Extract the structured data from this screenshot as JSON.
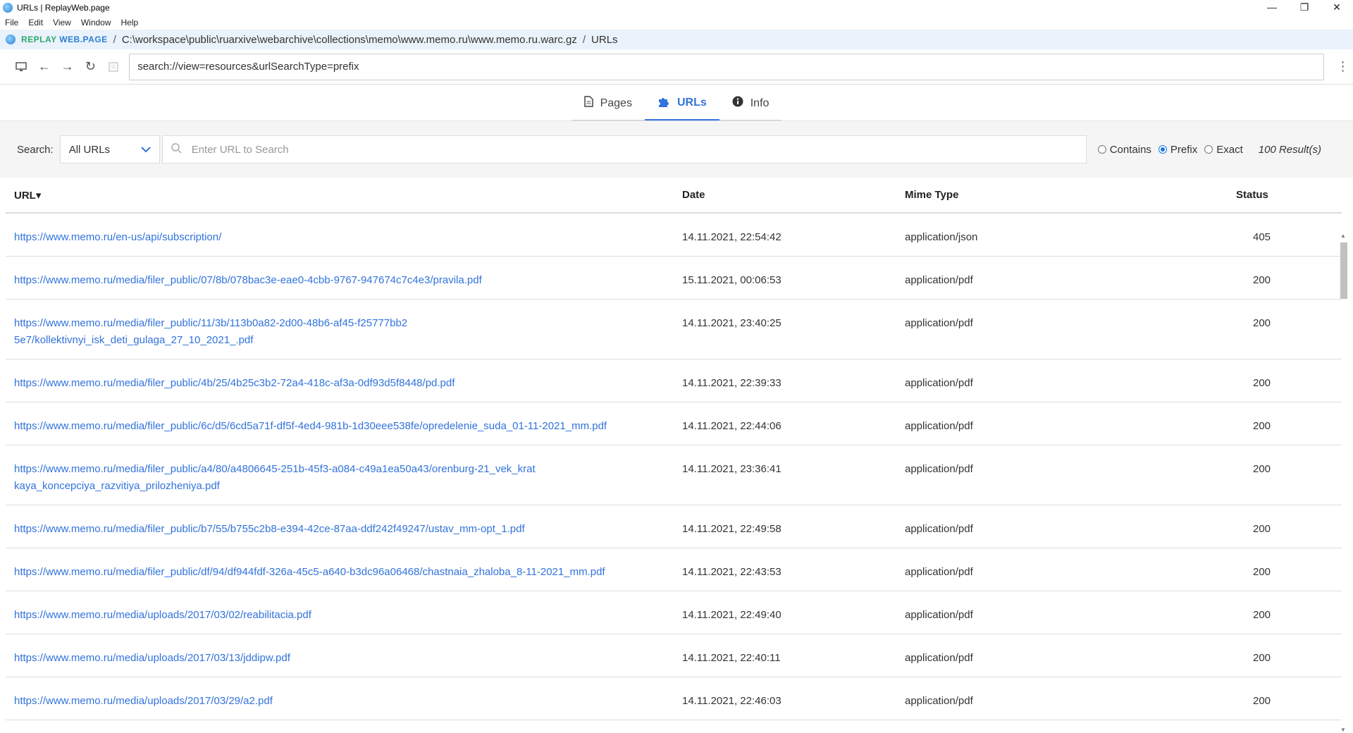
{
  "window": {
    "title": "URLs | ReplayWeb.page",
    "controls": [
      "—",
      "❐",
      "✕"
    ]
  },
  "menu": [
    "File",
    "Edit",
    "View",
    "Window",
    "Help"
  ],
  "breadcrumb": {
    "brand_replay": "REPLAY",
    "brand_web": "WEB.PAGE",
    "path": "C:\\workspace\\public\\ruarxive\\webarchive\\collections\\memo\\www.memo.ru\\www.memo.ru.warc.gz",
    "section": "URLs"
  },
  "address": {
    "value": "search://view=resources&urlSearchType=prefix"
  },
  "tabs": [
    {
      "label": "Pages",
      "icon": "page-icon",
      "active": false
    },
    {
      "label": "URLs",
      "icon": "puzzle-icon",
      "active": true
    },
    {
      "label": "Info",
      "icon": "info-icon",
      "active": false
    }
  ],
  "search": {
    "label": "Search:",
    "filter_value": "All URLs",
    "placeholder": "Enter URL to Search",
    "modes": [
      {
        "label": "Contains",
        "checked": false
      },
      {
        "label": "Prefix",
        "checked": true
      },
      {
        "label": "Exact",
        "checked": false
      }
    ],
    "results": "100 Result(s)"
  },
  "table": {
    "headers": {
      "url": "URL▾",
      "date": "Date",
      "mime": "Mime Type",
      "status": "Status"
    },
    "rows": [
      {
        "url": "https://www.memo.ru/en-us/api/subscription/",
        "date": "14.11.2021, 22:54:42",
        "mime": "application/json",
        "status": "405"
      },
      {
        "url": "https://www.memo.ru/media/filer_public/07/8b/078bac3e-eae0-4cbb-9767-947674c7c4e3/pravila.pdf",
        "date": "15.11.2021, 00:06:53",
        "mime": "application/pdf",
        "status": "200"
      },
      {
        "url": "https://www.memo.ru/media/filer_public/11/3b/113b0a82-2d00-48b6-af45-f25777bb25e7/kollektivnyi_isk_deti_gulaga_27_10_2021_.pdf",
        "date": "14.11.2021, 23:40:25",
        "mime": "application/pdf",
        "status": "200"
      },
      {
        "url": "https://www.memo.ru/media/filer_public/4b/25/4b25c3b2-72a4-418c-af3a-0df93d5f8448/pd.pdf",
        "date": "14.11.2021, 22:39:33",
        "mime": "application/pdf",
        "status": "200"
      },
      {
        "url": "https://www.memo.ru/media/filer_public/6c/d5/6cd5a71f-df5f-4ed4-981b-1d30eee538fe/opredelenie_suda_01-11-2021_mm.pdf",
        "date": "14.11.2021, 22:44:06",
        "mime": "application/pdf",
        "status": "200"
      },
      {
        "url": "https://www.memo.ru/media/filer_public/a4/80/a4806645-251b-45f3-a084-c49a1ea50a43/orenburg-21_vek_kratkaya_koncepciya_razvitiya_prilozheniya.pdf",
        "date": "14.11.2021, 23:36:41",
        "mime": "application/pdf",
        "status": "200"
      },
      {
        "url": "https://www.memo.ru/media/filer_public/b7/55/b755c2b8-e394-42ce-87aa-ddf242f49247/ustav_mm-opt_1.pdf",
        "date": "14.11.2021, 22:49:58",
        "mime": "application/pdf",
        "status": "200"
      },
      {
        "url": "https://www.memo.ru/media/filer_public/df/94/df944fdf-326a-45c5-a640-b3dc96a06468/chastnaia_zhaloba_8-11-2021_mm.pdf",
        "date": "14.11.2021, 22:43:53",
        "mime": "application/pdf",
        "status": "200"
      },
      {
        "url": "https://www.memo.ru/media/uploads/2017/03/02/reabilitacia.pdf",
        "date": "14.11.2021, 22:49:40",
        "mime": "application/pdf",
        "status": "200"
      },
      {
        "url": "https://www.memo.ru/media/uploads/2017/03/13/jddipw.pdf",
        "date": "14.11.2021, 22:40:11",
        "mime": "application/pdf",
        "status": "200"
      },
      {
        "url": "https://www.memo.ru/media/uploads/2017/03/29/a2.pdf",
        "date": "14.11.2021, 22:46:03",
        "mime": "application/pdf",
        "status": "200"
      }
    ]
  }
}
